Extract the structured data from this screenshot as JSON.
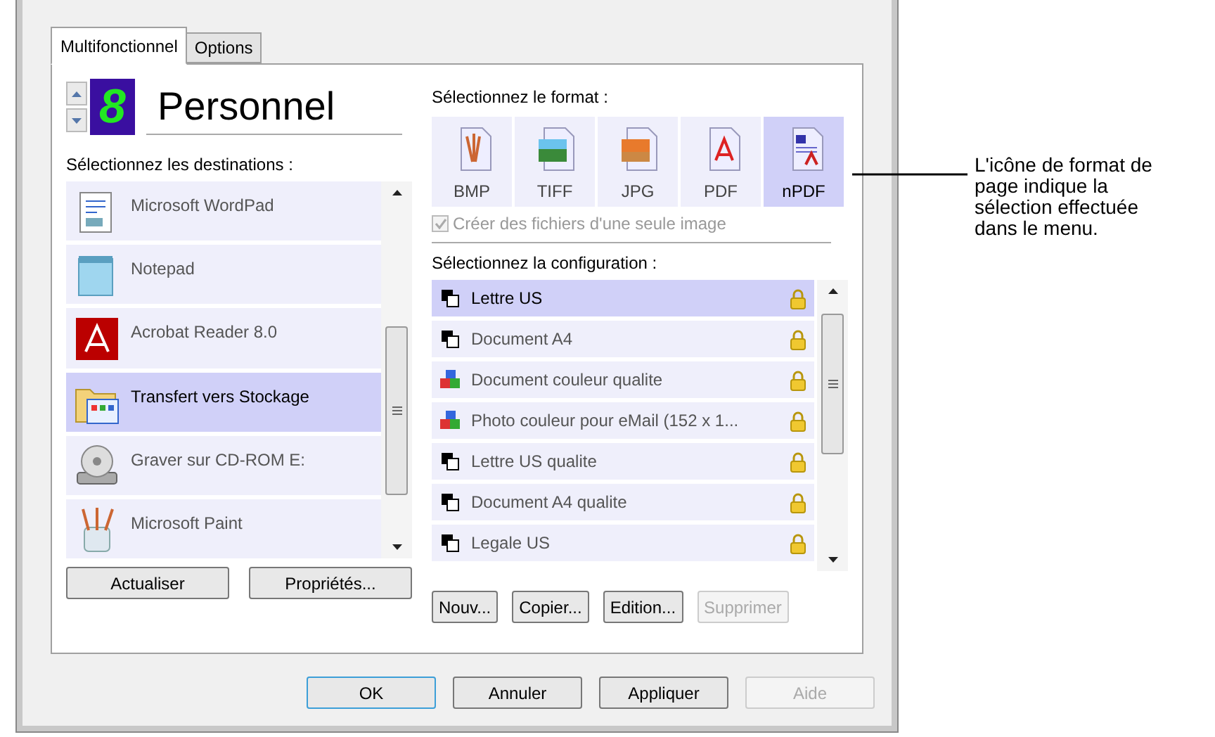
{
  "tabs": [
    {
      "label": "Multifonctionnel",
      "selected": true
    },
    {
      "label": "Options",
      "selected": false
    }
  ],
  "profile": {
    "digit": "8",
    "name": "Personnel"
  },
  "destinations": {
    "label": "Sélectionnez les destinations :",
    "items": [
      {
        "label": "Microsoft WordPad",
        "kind": "wordpad",
        "selected": false
      },
      {
        "label": "Notepad",
        "kind": "notepad",
        "selected": false
      },
      {
        "label": "Acrobat Reader 8.0",
        "kind": "acrobat",
        "selected": false
      },
      {
        "label": "Transfert vers Stockage",
        "kind": "folder",
        "selected": true
      },
      {
        "label": "Graver sur CD-ROM  E:",
        "kind": "cdrom",
        "selected": false
      },
      {
        "label": "Microsoft Paint",
        "kind": "paint",
        "selected": false
      }
    ],
    "buttons": [
      {
        "label": "Actualiser",
        "disabled": false
      },
      {
        "label": "Propriétés...",
        "disabled": false
      }
    ]
  },
  "format": {
    "label": "Sélectionnez le format :",
    "items": [
      {
        "label": "BMP",
        "kind": "bmp",
        "selected": false
      },
      {
        "label": "TIFF",
        "kind": "tiff",
        "selected": false
      },
      {
        "label": "JPG",
        "kind": "jpg",
        "selected": false
      },
      {
        "label": "PDF",
        "kind": "pdf",
        "selected": false
      },
      {
        "label": "nPDF",
        "kind": "npdf",
        "selected": true
      }
    ],
    "single_image": {
      "label": "Créer des fichiers d'une seule image",
      "checked": true,
      "disabled": true
    }
  },
  "configuration": {
    "label": "Sélectionnez la configuration :",
    "items": [
      {
        "label": "Lettre US",
        "kind": "bw",
        "selected": true
      },
      {
        "label": "Document A4",
        "kind": "bw",
        "selected": false
      },
      {
        "label": "Document couleur qualite",
        "kind": "color",
        "selected": false
      },
      {
        "label": "Photo couleur pour eMail (152 x 1...",
        "kind": "color",
        "selected": false
      },
      {
        "label": "Lettre US qualite",
        "kind": "bw",
        "selected": false
      },
      {
        "label": "Document A4 qualite",
        "kind": "bw",
        "selected": false
      },
      {
        "label": "Legale US",
        "kind": "bw",
        "selected": false
      }
    ],
    "buttons": [
      {
        "label": "Nouv...",
        "disabled": false
      },
      {
        "label": "Copier...",
        "disabled": false
      },
      {
        "label": "Edition...",
        "disabled": false
      },
      {
        "label": "Supprimer",
        "disabled": true
      }
    ]
  },
  "dialog_buttons": [
    {
      "label": "OK",
      "disabled": false,
      "default": true
    },
    {
      "label": "Annuler",
      "disabled": false,
      "default": false
    },
    {
      "label": "Appliquer",
      "disabled": false,
      "default": false
    },
    {
      "label": "Aide",
      "disabled": true,
      "default": false
    }
  ],
  "callout": "L'icône de format de page indique la sélection effectuée dans le menu."
}
